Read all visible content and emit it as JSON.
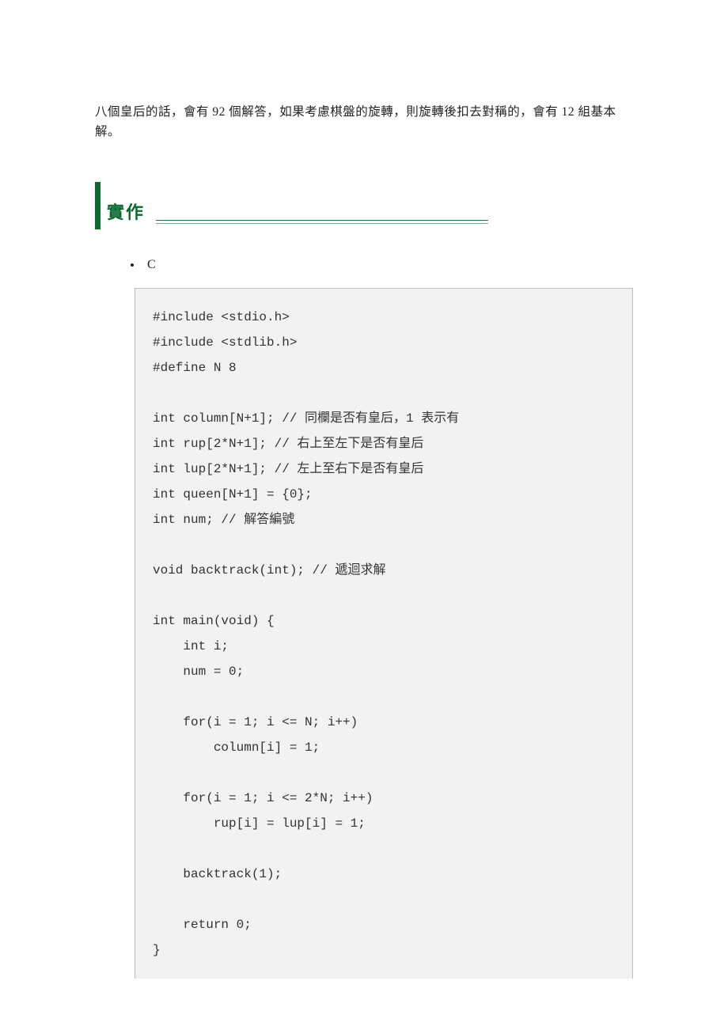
{
  "intro_paragraph": "八個皇后的話，會有 92 個解答，如果考慮棋盤的旋轉，則旋轉後扣去對稱的，會有 12 組基本解。",
  "section_title": "實作",
  "language_bullet": "C",
  "code": "#include <stdio.h>\n#include <stdlib.h>\n#define N 8\n\nint column[N+1]; // 同欄是否有皇后，1 表示有\nint rup[2*N+1]; // 右上至左下是否有皇后\nint lup[2*N+1]; // 左上至右下是否有皇后\nint queen[N+1] = {0};\nint num; // 解答編號\n\nvoid backtrack(int); // 遞迴求解\n\nint main(void) {\n    int i;\n    num = 0;\n\n    for(i = 1; i <= N; i++)\n        column[i] = 1;\n\n    for(i = 1; i <= 2*N; i++)\n        rup[i] = lup[i] = 1;\n\n    backtrack(1);\n\n    return 0;\n}"
}
